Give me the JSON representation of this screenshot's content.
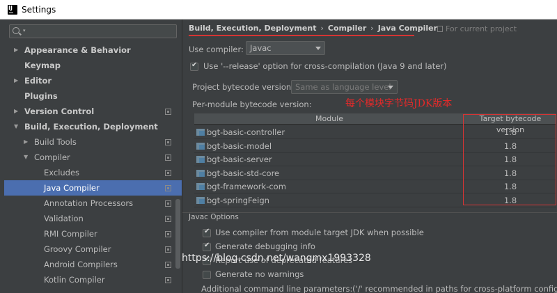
{
  "window": {
    "title": "Settings"
  },
  "sidebar": {
    "search_placeholder": "",
    "items": [
      {
        "label": "Appearance & Behavior",
        "level": 0,
        "arrow": "right",
        "bold": true,
        "project_icon": false
      },
      {
        "label": "Keymap",
        "level": 0,
        "arrow": "",
        "bold": true,
        "project_icon": false
      },
      {
        "label": "Editor",
        "level": 0,
        "arrow": "right",
        "bold": true,
        "project_icon": false
      },
      {
        "label": "Plugins",
        "level": 0,
        "arrow": "",
        "bold": true,
        "project_icon": false
      },
      {
        "label": "Version Control",
        "level": 0,
        "arrow": "right",
        "bold": true,
        "project_icon": true
      },
      {
        "label": "Build, Execution, Deployment",
        "level": 0,
        "arrow": "down",
        "bold": true,
        "project_icon": false
      },
      {
        "label": "Build Tools",
        "level": 1,
        "arrow": "right",
        "bold": false,
        "project_icon": true
      },
      {
        "label": "Compiler",
        "level": 1,
        "arrow": "down",
        "bold": false,
        "project_icon": true
      },
      {
        "label": "Excludes",
        "level": 2,
        "arrow": "",
        "bold": false,
        "project_icon": true
      },
      {
        "label": "Java Compiler",
        "level": 2,
        "arrow": "",
        "bold": false,
        "project_icon": true,
        "selected": true
      },
      {
        "label": "Annotation Processors",
        "level": 2,
        "arrow": "",
        "bold": false,
        "project_icon": true
      },
      {
        "label": "Validation",
        "level": 2,
        "arrow": "",
        "bold": false,
        "project_icon": true
      },
      {
        "label": "RMI Compiler",
        "level": 2,
        "arrow": "",
        "bold": false,
        "project_icon": true
      },
      {
        "label": "Groovy Compiler",
        "level": 2,
        "arrow": "",
        "bold": false,
        "project_icon": true
      },
      {
        "label": "Android Compilers",
        "level": 2,
        "arrow": "",
        "bold": false,
        "project_icon": true
      },
      {
        "label": "Kotlin Compiler",
        "level": 2,
        "arrow": "",
        "bold": false,
        "project_icon": true
      }
    ]
  },
  "breadcrumb": [
    "Build, Execution, Deployment",
    "Compiler",
    "Java Compiler"
  ],
  "for_current_project": "For current project",
  "use_compiler": {
    "label": "Use compiler:",
    "value": "Javac"
  },
  "release_option": {
    "label": "Use '--release' option for cross-compilation (Java 9 and later)",
    "checked": true
  },
  "project_bytecode": {
    "label": "Project bytecode version:",
    "value": "Same as language level"
  },
  "per_module_label": "Per-module bytecode version:",
  "annotation_text": "每个模块字节码JDK版本",
  "table": {
    "headers": [
      "Module",
      "Target bytecode version"
    ],
    "rows": [
      {
        "module": "bgt-basic-controller",
        "version": "1.8"
      },
      {
        "module": "bgt-basic-model",
        "version": "1.8"
      },
      {
        "module": "bgt-basic-server",
        "version": "1.8"
      },
      {
        "module": "bgt-basic-std-core",
        "version": "1.8"
      },
      {
        "module": "bgt-framework-com",
        "version": "1.8"
      },
      {
        "module": "bgt-springFeign",
        "version": "1.8"
      }
    ]
  },
  "javac_options": {
    "title": "Javac Options",
    "options": [
      {
        "label": "Use compiler from module target JDK when possible",
        "checked": true
      },
      {
        "label": "Generate debugging info",
        "checked": true
      },
      {
        "label": "Report use of deprecated features",
        "checked": true
      },
      {
        "label": "Generate no warnings",
        "checked": false
      }
    ],
    "additional_label": "Additional command line parameters:",
    "additional_hint": "('/' recommended in paths for cross-platform configurations)"
  },
  "watermark": "https://blog.csdn.net/wangmx1993328",
  "colors": {
    "selection": "#4b6eaf",
    "annotation": "#e32a2a",
    "background": "#3c3f41"
  }
}
